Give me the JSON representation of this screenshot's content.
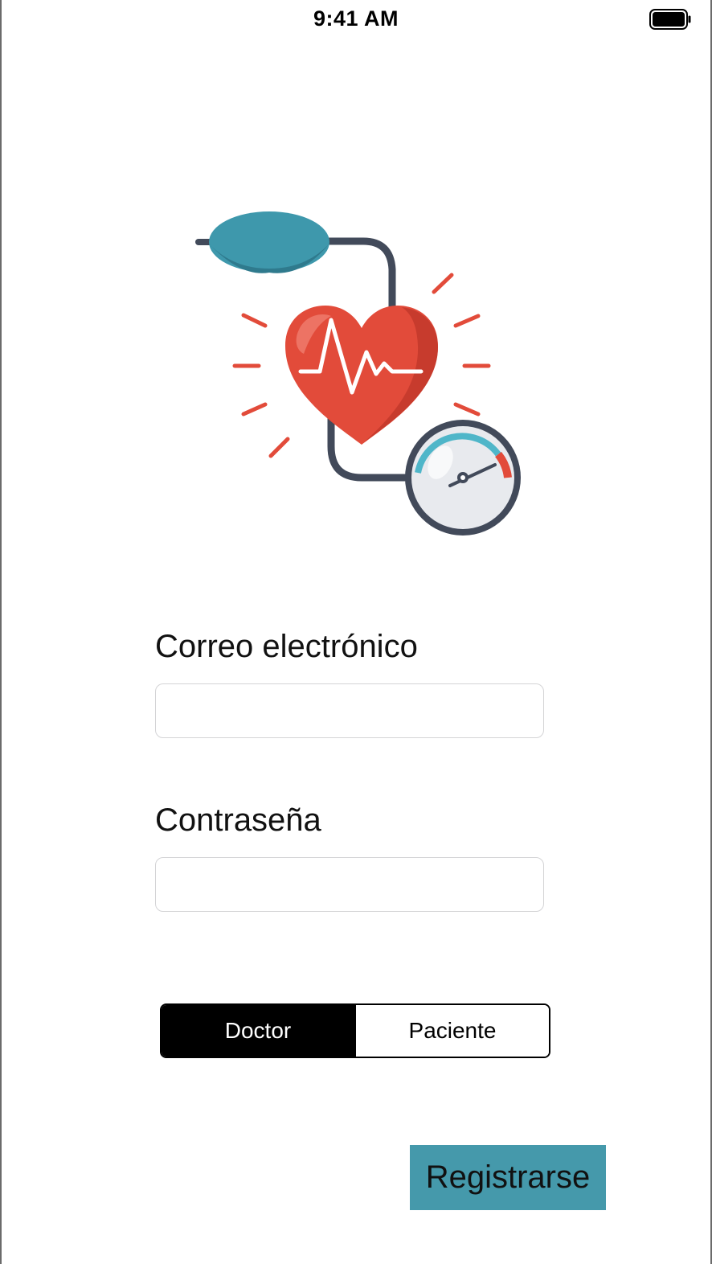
{
  "status_bar": {
    "time": "9:41 AM",
    "battery_icon": "battery-full-icon"
  },
  "illustration": {
    "icon": "blood-pressure-heart-icon",
    "colors": {
      "heart": "#e24b3a",
      "cuff": "#3e98ac",
      "tube": "#424a5a",
      "gauge_accent": "#4fb6c9"
    }
  },
  "form": {
    "email": {
      "label": "Correo electrónico",
      "value": "",
      "placeholder": ""
    },
    "password": {
      "label": "Contraseña",
      "value": "",
      "placeholder": ""
    }
  },
  "role_selector": {
    "options": [
      "Doctor",
      "Paciente"
    ],
    "selected": "Doctor"
  },
  "actions": {
    "register_label": "Registrarse",
    "register_color": "#4599ab"
  }
}
